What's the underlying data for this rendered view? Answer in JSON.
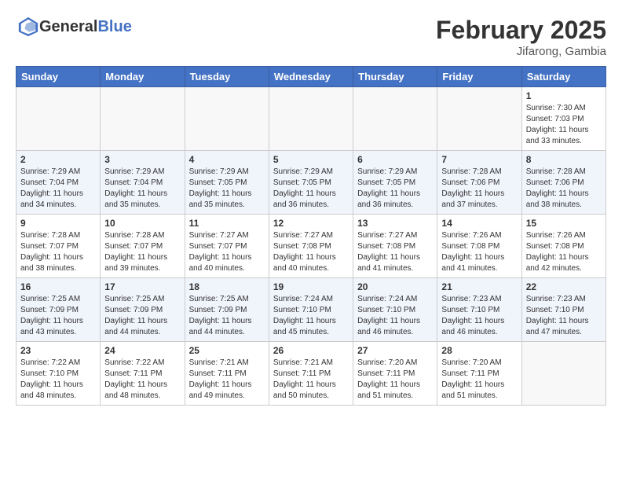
{
  "logo": {
    "text_general": "General",
    "text_blue": "Blue"
  },
  "header": {
    "month_year": "February 2025",
    "location": "Jifarong, Gambia"
  },
  "weekdays": [
    "Sunday",
    "Monday",
    "Tuesday",
    "Wednesday",
    "Thursday",
    "Friday",
    "Saturday"
  ],
  "weeks": [
    [
      {
        "day": "",
        "info": ""
      },
      {
        "day": "",
        "info": ""
      },
      {
        "day": "",
        "info": ""
      },
      {
        "day": "",
        "info": ""
      },
      {
        "day": "",
        "info": ""
      },
      {
        "day": "",
        "info": ""
      },
      {
        "day": "1",
        "info": "Sunrise: 7:30 AM\nSunset: 7:03 PM\nDaylight: 11 hours and 33 minutes."
      }
    ],
    [
      {
        "day": "2",
        "info": "Sunrise: 7:29 AM\nSunset: 7:04 PM\nDaylight: 11 hours and 34 minutes."
      },
      {
        "day": "3",
        "info": "Sunrise: 7:29 AM\nSunset: 7:04 PM\nDaylight: 11 hours and 35 minutes."
      },
      {
        "day": "4",
        "info": "Sunrise: 7:29 AM\nSunset: 7:05 PM\nDaylight: 11 hours and 35 minutes."
      },
      {
        "day": "5",
        "info": "Sunrise: 7:29 AM\nSunset: 7:05 PM\nDaylight: 11 hours and 36 minutes."
      },
      {
        "day": "6",
        "info": "Sunrise: 7:29 AM\nSunset: 7:05 PM\nDaylight: 11 hours and 36 minutes."
      },
      {
        "day": "7",
        "info": "Sunrise: 7:28 AM\nSunset: 7:06 PM\nDaylight: 11 hours and 37 minutes."
      },
      {
        "day": "8",
        "info": "Sunrise: 7:28 AM\nSunset: 7:06 PM\nDaylight: 11 hours and 38 minutes."
      }
    ],
    [
      {
        "day": "9",
        "info": "Sunrise: 7:28 AM\nSunset: 7:07 PM\nDaylight: 11 hours and 38 minutes."
      },
      {
        "day": "10",
        "info": "Sunrise: 7:28 AM\nSunset: 7:07 PM\nDaylight: 11 hours and 39 minutes."
      },
      {
        "day": "11",
        "info": "Sunrise: 7:27 AM\nSunset: 7:07 PM\nDaylight: 11 hours and 40 minutes."
      },
      {
        "day": "12",
        "info": "Sunrise: 7:27 AM\nSunset: 7:08 PM\nDaylight: 11 hours and 40 minutes."
      },
      {
        "day": "13",
        "info": "Sunrise: 7:27 AM\nSunset: 7:08 PM\nDaylight: 11 hours and 41 minutes."
      },
      {
        "day": "14",
        "info": "Sunrise: 7:26 AM\nSunset: 7:08 PM\nDaylight: 11 hours and 41 minutes."
      },
      {
        "day": "15",
        "info": "Sunrise: 7:26 AM\nSunset: 7:08 PM\nDaylight: 11 hours and 42 minutes."
      }
    ],
    [
      {
        "day": "16",
        "info": "Sunrise: 7:25 AM\nSunset: 7:09 PM\nDaylight: 11 hours and 43 minutes."
      },
      {
        "day": "17",
        "info": "Sunrise: 7:25 AM\nSunset: 7:09 PM\nDaylight: 11 hours and 44 minutes."
      },
      {
        "day": "18",
        "info": "Sunrise: 7:25 AM\nSunset: 7:09 PM\nDaylight: 11 hours and 44 minutes."
      },
      {
        "day": "19",
        "info": "Sunrise: 7:24 AM\nSunset: 7:10 PM\nDaylight: 11 hours and 45 minutes."
      },
      {
        "day": "20",
        "info": "Sunrise: 7:24 AM\nSunset: 7:10 PM\nDaylight: 11 hours and 46 minutes."
      },
      {
        "day": "21",
        "info": "Sunrise: 7:23 AM\nSunset: 7:10 PM\nDaylight: 11 hours and 46 minutes."
      },
      {
        "day": "22",
        "info": "Sunrise: 7:23 AM\nSunset: 7:10 PM\nDaylight: 11 hours and 47 minutes."
      }
    ],
    [
      {
        "day": "23",
        "info": "Sunrise: 7:22 AM\nSunset: 7:10 PM\nDaylight: 11 hours and 48 minutes."
      },
      {
        "day": "24",
        "info": "Sunrise: 7:22 AM\nSunset: 7:11 PM\nDaylight: 11 hours and 48 minutes."
      },
      {
        "day": "25",
        "info": "Sunrise: 7:21 AM\nSunset: 7:11 PM\nDaylight: 11 hours and 49 minutes."
      },
      {
        "day": "26",
        "info": "Sunrise: 7:21 AM\nSunset: 7:11 PM\nDaylight: 11 hours and 50 minutes."
      },
      {
        "day": "27",
        "info": "Sunrise: 7:20 AM\nSunset: 7:11 PM\nDaylight: 11 hours and 51 minutes."
      },
      {
        "day": "28",
        "info": "Sunrise: 7:20 AM\nSunset: 7:11 PM\nDaylight: 11 hours and 51 minutes."
      },
      {
        "day": "",
        "info": ""
      }
    ]
  ]
}
